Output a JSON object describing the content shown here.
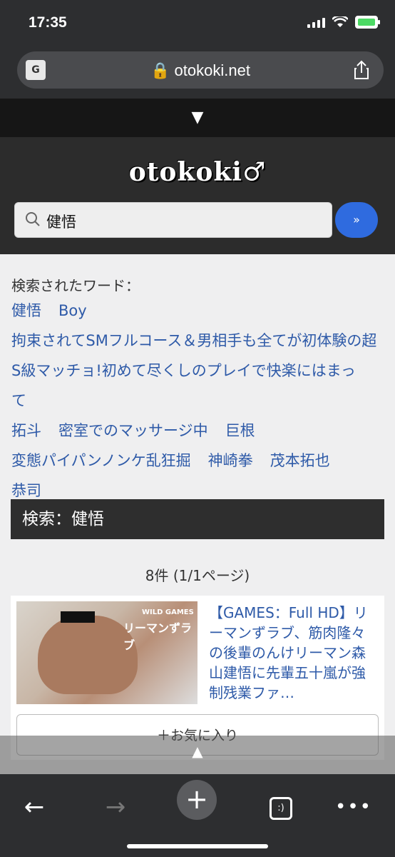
{
  "status": {
    "time": "17:35",
    "battery_color": "#4cd964"
  },
  "browser": {
    "url": "otokoki.net",
    "lock_icon": "lock-icon",
    "translate_icon": "translate-icon",
    "share_icon": "share-icon"
  },
  "menu": {
    "toggle_label": "▼"
  },
  "site": {
    "logo": "otokoki♂",
    "search": {
      "value": "健悟",
      "button_label": "»",
      "button_color": "#2f6bdf"
    }
  },
  "searched": {
    "title": "検索されたワード：",
    "words": [
      "健悟",
      "Boy",
      "拘束されてSMフルコース＆男相手も全てが初体験の超S級マッチョ!初めて尽くしのプレイで快楽にはまって",
      "拓斗",
      "密室でのマッサージ中",
      "巨根",
      "変態パイパンノンケ乱狂掘",
      "神崎拳",
      "茂本拓也",
      "恭司"
    ]
  },
  "results": {
    "section_title": "検索：健悟",
    "count": "8件 (1/1ページ)",
    "items": [
      {
        "title": "【GAMES：Full HD】リーマンずラブ、筋肉隆々の後輩のんけリーマン森山建悟に先輩五十嵐が強制残業ファ…",
        "thumb_label_top": "WILD GAMES",
        "thumb_label_main": "リーマンずラブ",
        "favorite_label": "＋お気に入り"
      }
    ]
  },
  "toolbar": {
    "back": "←",
    "forward": "→",
    "new_tab": "+",
    "tabs": ":)",
    "more": "•••"
  }
}
